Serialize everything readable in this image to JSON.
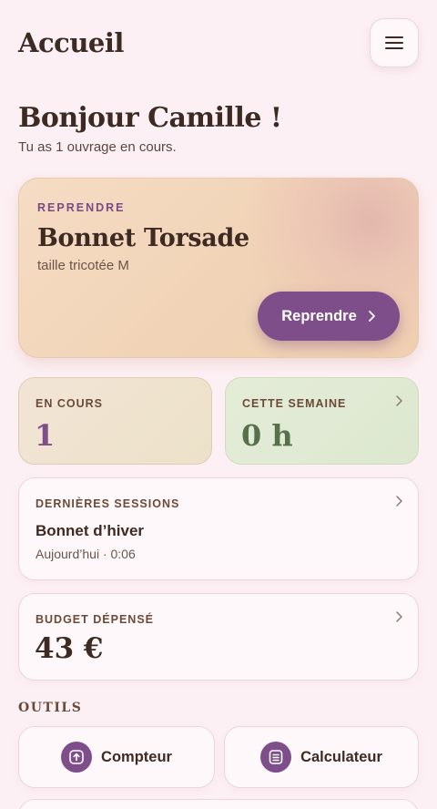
{
  "header": {
    "title": "Accueil"
  },
  "greeting": {
    "title": "Bonjour Camille !",
    "subtitle": "Tu as 1 ouvrage en cours."
  },
  "resume_card": {
    "kicker": "REPRENDRE",
    "project_name": "Bonnet Torsade",
    "project_detail": "taille tricotée M",
    "button_label": "Reprendre"
  },
  "stats": {
    "in_progress": {
      "label": "EN COURS",
      "value": "1"
    },
    "this_week": {
      "label": "CETTE SEMAINE",
      "value": "0 h"
    }
  },
  "sessions": {
    "label": "DERNIÈRES SESSIONS",
    "items": [
      {
        "name": "Bonnet d’hiver",
        "meta": "Aujourd’hui · 0:06"
      }
    ]
  },
  "budget": {
    "label": "BUDGET DÉPENSÉ",
    "value": "43 €"
  },
  "tools": {
    "title": "OUTILS",
    "items": [
      {
        "label": "Compteur",
        "icon": "counter-icon"
      },
      {
        "label": "Calculateur",
        "icon": "calculator-icon"
      }
    ]
  },
  "colors": {
    "background": "#fdf0f4",
    "accent": "#7d4e8a",
    "text": "#3d2a22",
    "green": "#55714a"
  }
}
